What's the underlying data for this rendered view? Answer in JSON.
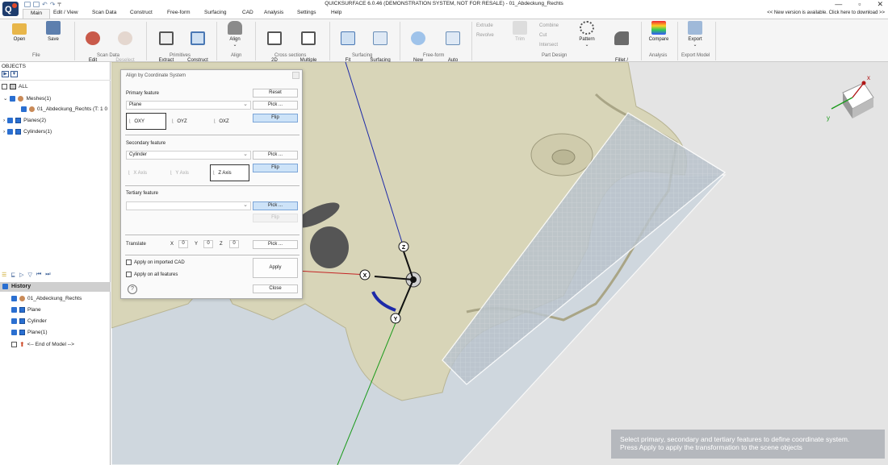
{
  "titlebar": {
    "title": "QUICKSURFACE 6.0.46 (DEMONSTRATION SYSTEM, NOT FOR RESALE) - 01_Abdeckung_Rechts"
  },
  "menu": {
    "tabs": [
      "Main",
      "Edit / View",
      "Scan Data",
      "Construct",
      "Free-form",
      "Surfacing",
      "CAD",
      "Analysis",
      "Settings",
      "Help"
    ],
    "update_notice": "<< New version is available. Click here to download >>"
  },
  "ribbon": {
    "buttons": {
      "open": "Open",
      "save": "Save",
      "edit_scan": "Edit\nScan",
      "deselect_all": "Deselect\nAll",
      "extract": "Extract\nprimitives",
      "construct": "Construct",
      "align": "Align",
      "sketch": "2D\nSketch",
      "multiple_sections": "Multiple\nsections",
      "fit_surface": "Fit\nSurface",
      "surfacing": "Surfacing",
      "new_freeform": "New\nFree-form",
      "auto_surface": "Auto\nSurface",
      "extrude": "Extrude",
      "revolve": "Revolve",
      "trim": "Trim",
      "combine": "Combine",
      "cut": "Cut",
      "intersect": "Intersect",
      "pattern": "Pattern",
      "fillet": "Fillet /\nChamfer",
      "compare": "Compare",
      "export": "Export"
    },
    "groups": {
      "file": "File",
      "scan_data": "Scan Data",
      "primitives": "Primitives",
      "align": "Align",
      "cross_sections": "Cross sections",
      "surfacing": "Surfacing",
      "freeform": "Free-form",
      "part_design": "Part Design",
      "analysis": "Analysis",
      "export_model": "Export Model"
    }
  },
  "objects": {
    "label": "OBJECTS",
    "all": "ALL",
    "meshes": "Meshes(1)",
    "mesh_item": "01_Abdeckung_Rechts (T: 1 0",
    "planes": "Planes(2)",
    "cylinders": "Cylinders(1)"
  },
  "history": {
    "label": "History",
    "items": [
      "01_Abdeckung_Rechts",
      "Plane",
      "Cylinder",
      "Plane(1)",
      "<-- End of Model -->"
    ]
  },
  "dialog": {
    "title": "Align by Coordinate System",
    "primary_label": "Primary feature",
    "primary_value": "Plane",
    "reset": "Reset",
    "pick": "Pick ...",
    "flip": "Flip",
    "primary_orient": [
      "OXY",
      "OYZ",
      "OXZ"
    ],
    "secondary_label": "Secondary feature",
    "secondary_value": "Cylinder",
    "secondary_orient": [
      "X Axis",
      "Y Axis",
      "Z Axis"
    ],
    "tertiary_label": "Tertiary feature",
    "tertiary_value": "",
    "translate_label": "Translate",
    "translate": {
      "x_label": "X",
      "x": "0",
      "y_label": "Y",
      "y": "0",
      "z_label": "Z",
      "z": "0"
    },
    "apply_cad": "Apply on imported CAD",
    "apply_all": "Apply on all features",
    "apply": "Apply",
    "close": "Close",
    "help": "?"
  },
  "viewport": {
    "axis_x": "X",
    "axis_y": "Y",
    "axis_z": "Z",
    "cube_x": "x",
    "cube_y": "y",
    "hint_line1": "Select primary, secondary and tertiary features to define coordinate system.",
    "hint_line2": "Press Apply to apply the transformation to the scene objects"
  },
  "colors": {
    "accent": "#2a6fd1",
    "part": "#d8d5b8",
    "plane": "#b7c4cf",
    "selected_btn": "#cde3f8"
  }
}
